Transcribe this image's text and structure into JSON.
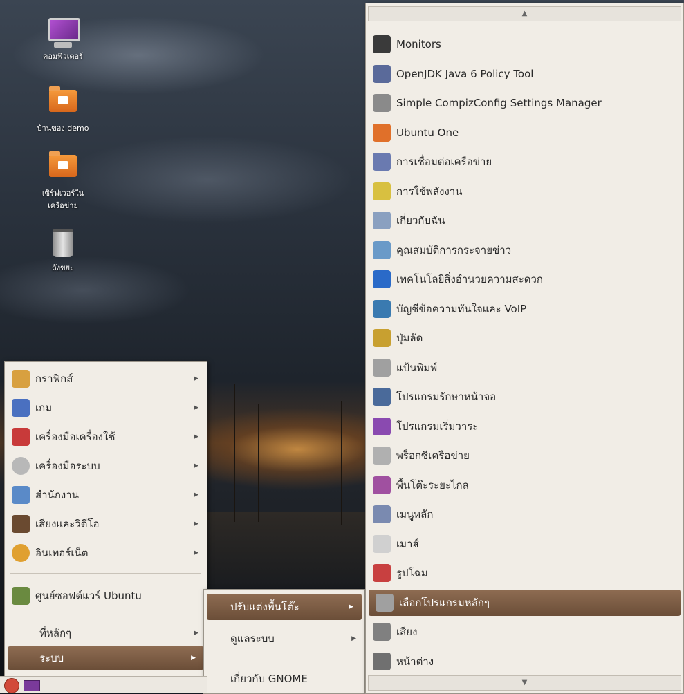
{
  "desktop_icons": [
    {
      "label": "คอมพิวเตอร์",
      "icon": "computer-icon"
    },
    {
      "label": "บ้านของ demo",
      "icon": "home-folder-icon"
    },
    {
      "label": "เซิร์ฟเวอร์ใน",
      "label2": "เครือข่าย",
      "icon": "network-folder-icon"
    },
    {
      "label": "ถังขยะ",
      "icon": "trash-icon"
    }
  ],
  "main_menu": {
    "items": [
      {
        "label": "กราฟิกส์",
        "icon": "graphics-icon",
        "color": "#d8a040"
      },
      {
        "label": "เกม",
        "icon": "games-icon",
        "color": "#4a70c0"
      },
      {
        "label": "เครื่องมือเครื่องใช้",
        "icon": "accessories-icon",
        "color": "#c83a3a"
      },
      {
        "label": "เครื่องมือระบบ",
        "icon": "system-tools-icon",
        "color": "#b8b8b8"
      },
      {
        "label": "สำนักงาน",
        "icon": "office-icon",
        "color": "#5a8ac8"
      },
      {
        "label": "เสียงและวิดีโอ",
        "icon": "sound-video-icon",
        "color": "#6a4a30"
      },
      {
        "label": "อินเทอร์เน็ต",
        "icon": "internet-icon",
        "color": "#e0a030"
      }
    ],
    "software_center": {
      "label": "ศูนย์ซอฟต์แวร์ Ubuntu",
      "icon": "software-center-icon"
    },
    "places": {
      "label": "ที่หลักๆ"
    },
    "system": {
      "label": "ระบบ"
    }
  },
  "system_submenu": {
    "preferences": "ปรับแต่งพื้นโต๊ะ",
    "administration": "ดูแลระบบ",
    "about_gnome": "เกี่ยวกับ GNOME"
  },
  "preferences_submenu": {
    "scroll_up": "▲",
    "scroll_down": "▼",
    "items": [
      {
        "label": "Monitors",
        "icon": "monitors-icon",
        "color": "#3a3a3a"
      },
      {
        "label": "OpenJDK Java 6 Policy Tool",
        "icon": "java-policy-icon",
        "color": "#5a6a9a"
      },
      {
        "label": "Simple CompizConfig Settings Manager",
        "icon": "compizconfig-icon",
        "color": "#8a8a8a"
      },
      {
        "label": "Ubuntu One",
        "icon": "ubuntu-one-icon",
        "color": "#e0702a"
      },
      {
        "label": "การเชื่อมต่อเครือข่าย",
        "icon": "network-connections-icon",
        "color": "#6a7ab0"
      },
      {
        "label": "การใช้พลังงาน",
        "icon": "power-management-icon",
        "color": "#d8c040"
      },
      {
        "label": "เกี่ยวกับฉัน",
        "icon": "about-me-icon",
        "color": "#8aa0c0"
      },
      {
        "label": "คุณสมบัติการกระจายข่าว",
        "icon": "feed-properties-icon",
        "color": "#6a9ac8"
      },
      {
        "label": "เทคโนโลยีสิ่งอำนวยความสะดวก",
        "icon": "accessibility-icon",
        "color": "#2a6ac8"
      },
      {
        "label": "บัญชีข้อความทันใจและ VoIP",
        "icon": "im-accounts-icon",
        "color": "#3a7ab0"
      },
      {
        "label": "ปุ่มลัด",
        "icon": "keyboard-shortcuts-icon",
        "color": "#c8a030"
      },
      {
        "label": "แป้นพิมพ์",
        "icon": "keyboard-icon",
        "color": "#a0a0a0"
      },
      {
        "label": "โปรแกรมรักษาหน้าจอ",
        "icon": "screensaver-icon",
        "color": "#4a6a9a"
      },
      {
        "label": "โปรแกรมเริ่มวาระ",
        "icon": "startup-apps-icon",
        "color": "#8a4ab0"
      },
      {
        "label": "พร็อกซีเครือข่าย",
        "icon": "network-proxy-icon",
        "color": "#b0b0b0"
      },
      {
        "label": "พื้นโต๊ะระยะไกล",
        "icon": "remote-desktop-icon",
        "color": "#a050a0"
      },
      {
        "label": "เมนูหลัก",
        "icon": "main-menu-icon",
        "color": "#7a8ab0"
      },
      {
        "label": "เมาส์",
        "icon": "mouse-icon",
        "color": "#d0d0d0"
      },
      {
        "label": "รูปโฉม",
        "icon": "appearance-icon",
        "color": "#c84040"
      },
      {
        "label": "เลือกโปรแกรมหลักๆ",
        "icon": "preferred-apps-icon",
        "color": "#a0a0a0"
      },
      {
        "label": "เสียง",
        "icon": "sound-icon",
        "color": "#808080"
      },
      {
        "label": "หน้าต่าง",
        "icon": "windows-icon",
        "color": "#707070"
      }
    ]
  },
  "panel": {
    "menu_icon": "ubuntu-menu-icon",
    "workspace_icon": "workspace-icon"
  }
}
